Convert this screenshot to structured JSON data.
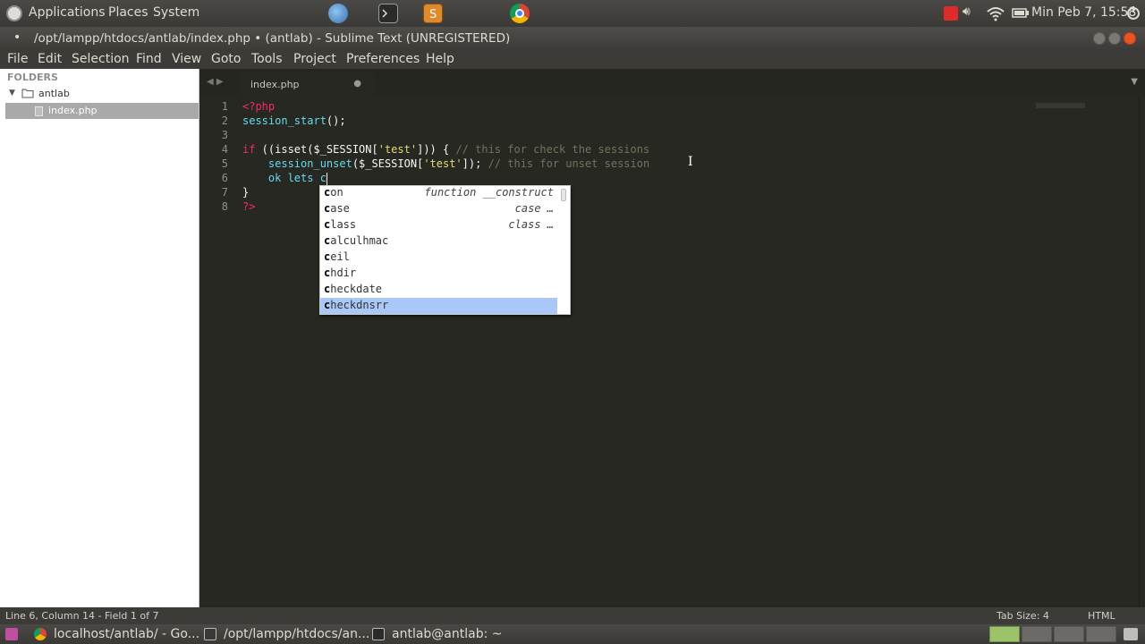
{
  "top_panel": {
    "menus": [
      "Applications",
      "Places",
      "System"
    ],
    "clock": "Min Peb  7, 15:58"
  },
  "window": {
    "title": "/opt/lampp/htdocs/antlab/index.php • (antlab) - Sublime Text (UNREGISTERED)",
    "modified_dot": "•"
  },
  "menubar": [
    "File",
    "Edit",
    "Selection",
    "Find",
    "View",
    "Goto",
    "Tools",
    "Project",
    "Preferences",
    "Help"
  ],
  "sidebar": {
    "header": "FOLDERS",
    "folder": "antlab",
    "file": "index.php"
  },
  "tab": {
    "label": "index.php",
    "dirty": "●"
  },
  "editor": {
    "line_numbers": [
      "1",
      "2",
      "3",
      "4",
      "5",
      "6",
      "7",
      "8"
    ],
    "lines": [
      "<?php",
      "session_start();",
      "",
      "if (isset($_SESSION['test'])) { // this for check the sessions",
      "    session_unset($_SESSION['test']); // this for unset session",
      "    ok lets c",
      "}",
      "?>"
    ]
  },
  "autocomplete": {
    "items": [
      {
        "first": "c",
        "rest": "on",
        "hint": "function __construct"
      },
      {
        "first": "c",
        "rest": "ase",
        "hint": "case …"
      },
      {
        "first": "c",
        "rest": "lass",
        "hint": "class …"
      },
      {
        "first": "c",
        "rest": "alculhmac",
        "hint": ""
      },
      {
        "first": "c",
        "rest": "eil",
        "hint": ""
      },
      {
        "first": "c",
        "rest": "hdir",
        "hint": ""
      },
      {
        "first": "c",
        "rest": "heckdate",
        "hint": ""
      },
      {
        "first": "c",
        "rest": "heckdnsrr",
        "hint": ""
      }
    ],
    "selected_index": 7
  },
  "statusbar": {
    "position": "Line 6, Column 14 - Field 1 of 7",
    "tab_size": "Tab Size: 4",
    "syntax": "HTML"
  },
  "taskbar": [
    {
      "label": "localhost/antlab/ - Go...",
      "icon": "chrome-icon"
    },
    {
      "label": "/opt/lampp/htdocs/an...",
      "icon": "sublime-icon"
    },
    {
      "label": "antlab@antlab: ~",
      "icon": "terminal-icon"
    }
  ],
  "colors": {
    "editor_bg": "#272822",
    "keyword": "#f92672",
    "function": "#66d9ef",
    "string": "#e6db74",
    "comment": "#75715e",
    "selection": "#aac8f7"
  }
}
